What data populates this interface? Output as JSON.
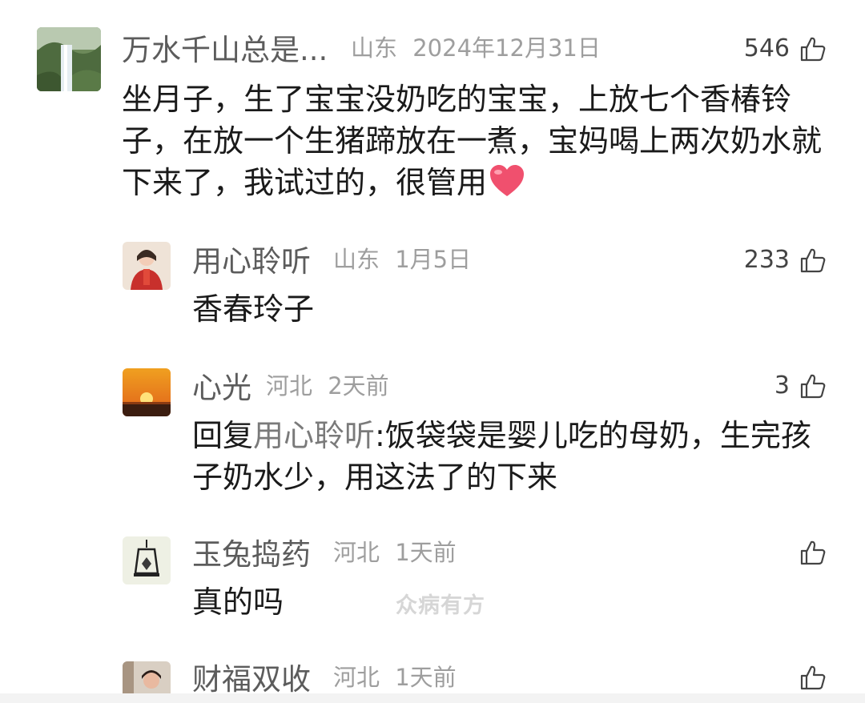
{
  "comments": [
    {
      "username": "万水千山总是...",
      "location": "山东",
      "date": "2024年12月31日",
      "likes": "546",
      "text": "坐月子，生了宝宝没奶吃的宝宝，上放七个香椿铃子，在放一个生猪蹄放在一煮，宝妈喝上两次奶水就下来了，我试过的，很管用",
      "emoji": "heart-emoji"
    },
    {
      "username": "用心聆听",
      "location": "山东",
      "date": "1月5日",
      "likes": "233",
      "text": "香春玲子"
    },
    {
      "username": "心光",
      "location": "河北",
      "date": "2天前",
      "likes": "3",
      "reply_prefix": "回复",
      "reply_to": "用心聆听",
      "text": ":饭袋袋是婴儿吃的母奶，生完孩子奶水少，用这法了的下来"
    },
    {
      "username": "玉兔捣药",
      "location": "河北",
      "date": "1天前",
      "likes": "",
      "text": "真的吗"
    },
    {
      "username": "财福双收",
      "location": "河北",
      "date": "1天前",
      "likes": ""
    }
  ],
  "watermark": "众病有方",
  "colors": {
    "name": "#5c5c5c",
    "meta": "#9e9e9e",
    "text": "#1a1a1a",
    "mention": "#7a7a7a",
    "heart": "#f0506e"
  }
}
